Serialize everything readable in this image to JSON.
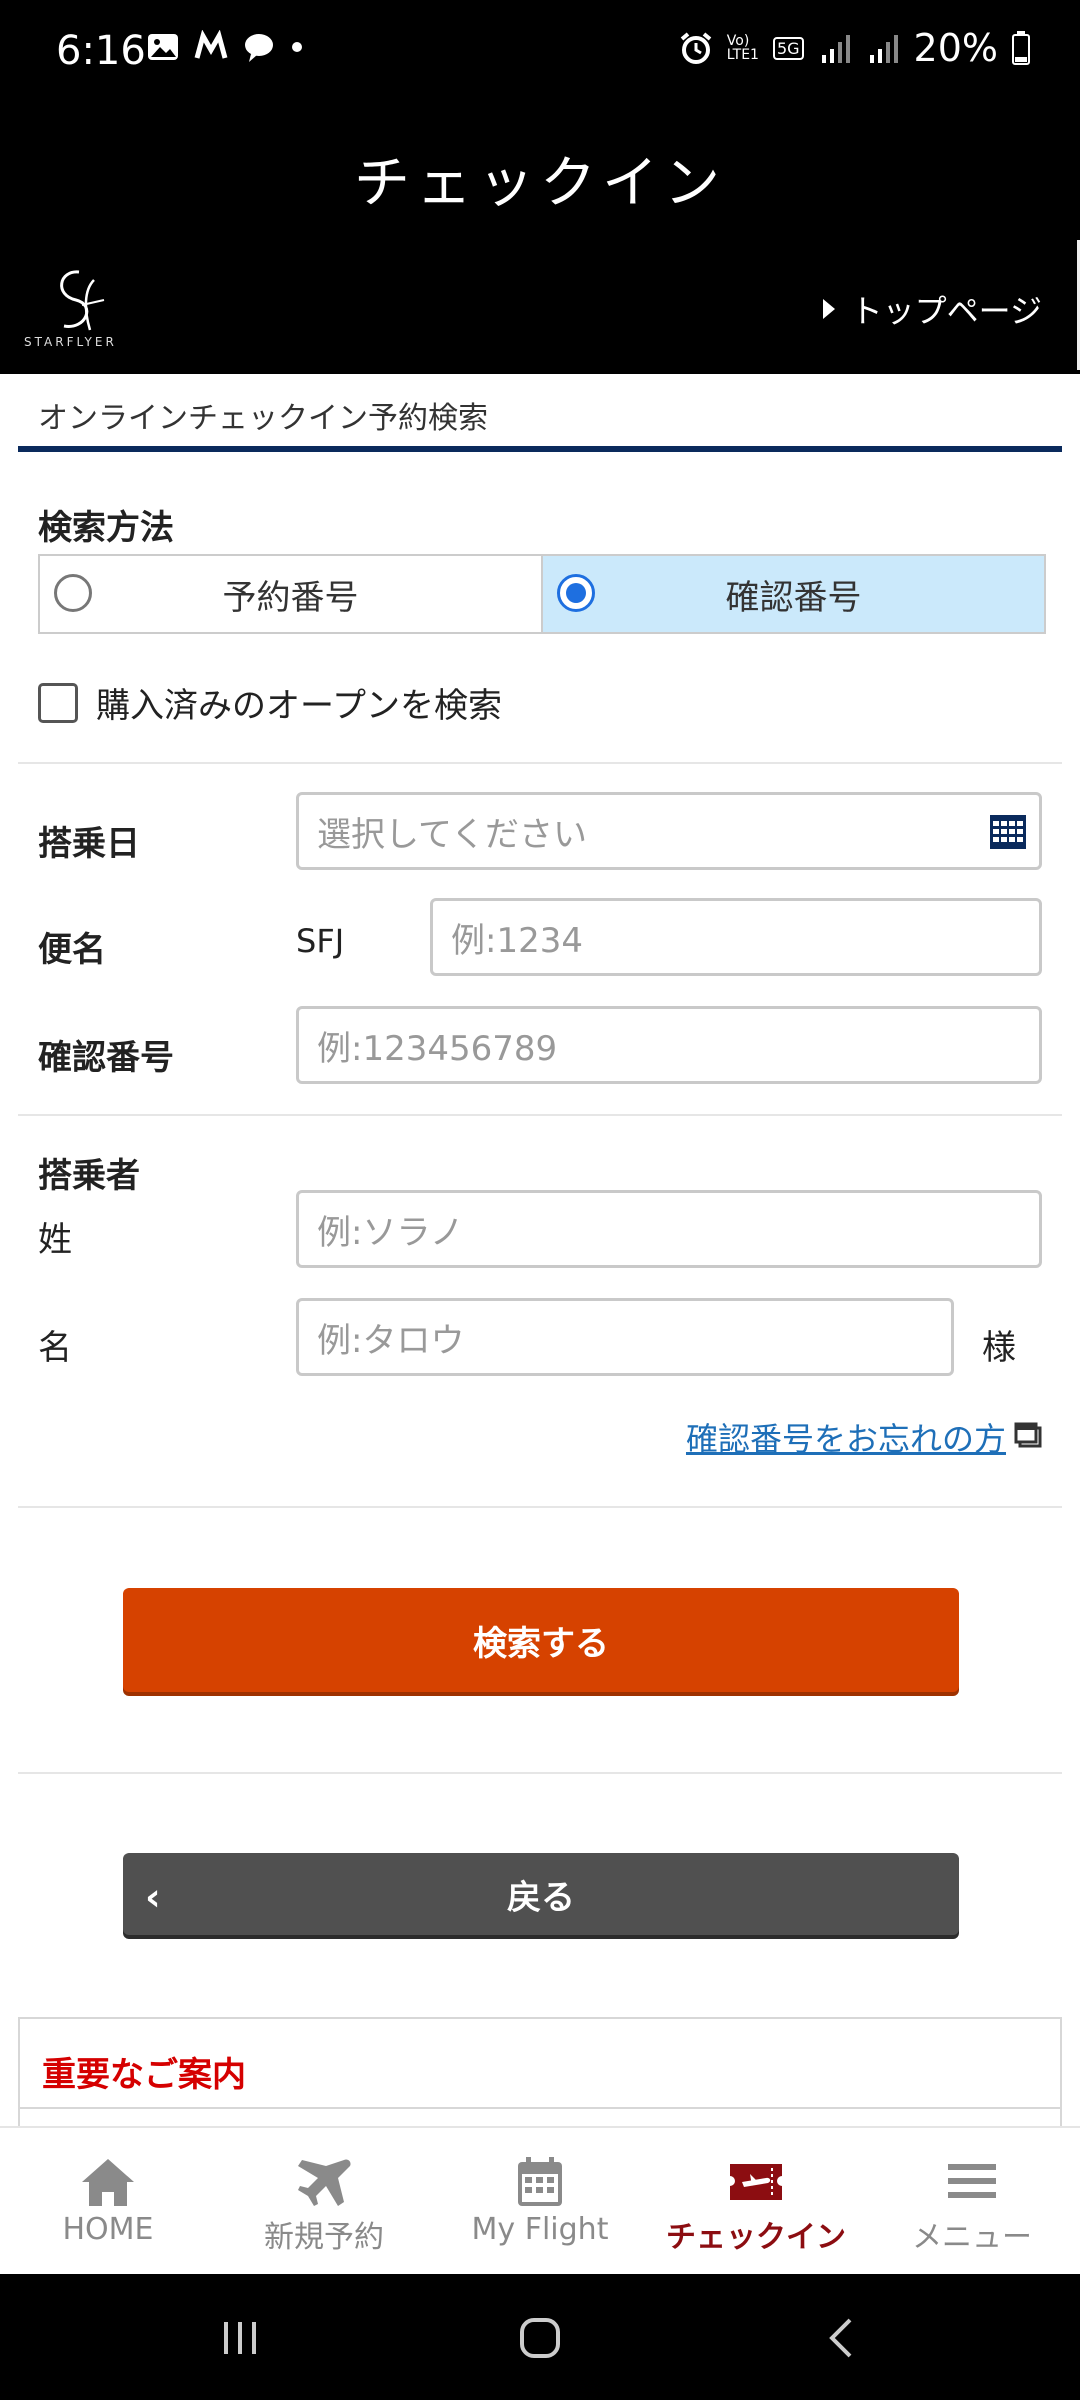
{
  "status_bar": {
    "time": "6:16",
    "network_label_top": "Vo)",
    "network_label_bottom": "LTE1",
    "network_5g": "5G",
    "battery": "20%"
  },
  "header": {
    "title": "チェックイン",
    "logo_text": "STARFLYER",
    "top_page_link": "トップページ"
  },
  "page": {
    "subtitle": "オンラインチェックイン予約検索"
  },
  "search_method": {
    "label": "検索方法",
    "options": [
      {
        "label": "予約番号",
        "selected": false
      },
      {
        "label": "確認番号",
        "selected": true
      }
    ],
    "open_ticket_checkbox": "購入済みのオープンを検索"
  },
  "fields": {
    "boarding_date_label": "搭乗日",
    "boarding_date_placeholder": "選択してください",
    "flight_label": "便名",
    "flight_prefix": "SFJ",
    "flight_placeholder": "例:1234",
    "confirmation_label": "確認番号",
    "confirmation_placeholder": "例:123456789"
  },
  "passenger": {
    "label": "搭乗者",
    "last_name_label": "姓",
    "last_name_placeholder": "例:ソラノ",
    "first_name_label": "名",
    "first_name_placeholder": "例:タロウ",
    "honorific": "様",
    "forgot_link": "確認番号をお忘れの方"
  },
  "buttons": {
    "search": "検索する",
    "back": "戻る"
  },
  "notice": {
    "title": "重要なご案内"
  },
  "bottom_nav": {
    "items": [
      {
        "label": "HOME",
        "icon": "home-icon"
      },
      {
        "label": "新規予約",
        "icon": "airplane-icon"
      },
      {
        "label": "My Flight",
        "icon": "calendar-icon"
      },
      {
        "label": "チェックイン",
        "icon": "boarding-pass-icon",
        "active": true
      },
      {
        "label": "メニュー",
        "icon": "hamburger-menu-icon"
      }
    ]
  },
  "colors": {
    "accent_orange": "#d64200",
    "selected_radio_bg": "#cbe9fb",
    "active_nav": "#8c0d11",
    "notice_red": "#d50000",
    "navy_rule": "#0a2a5c"
  }
}
